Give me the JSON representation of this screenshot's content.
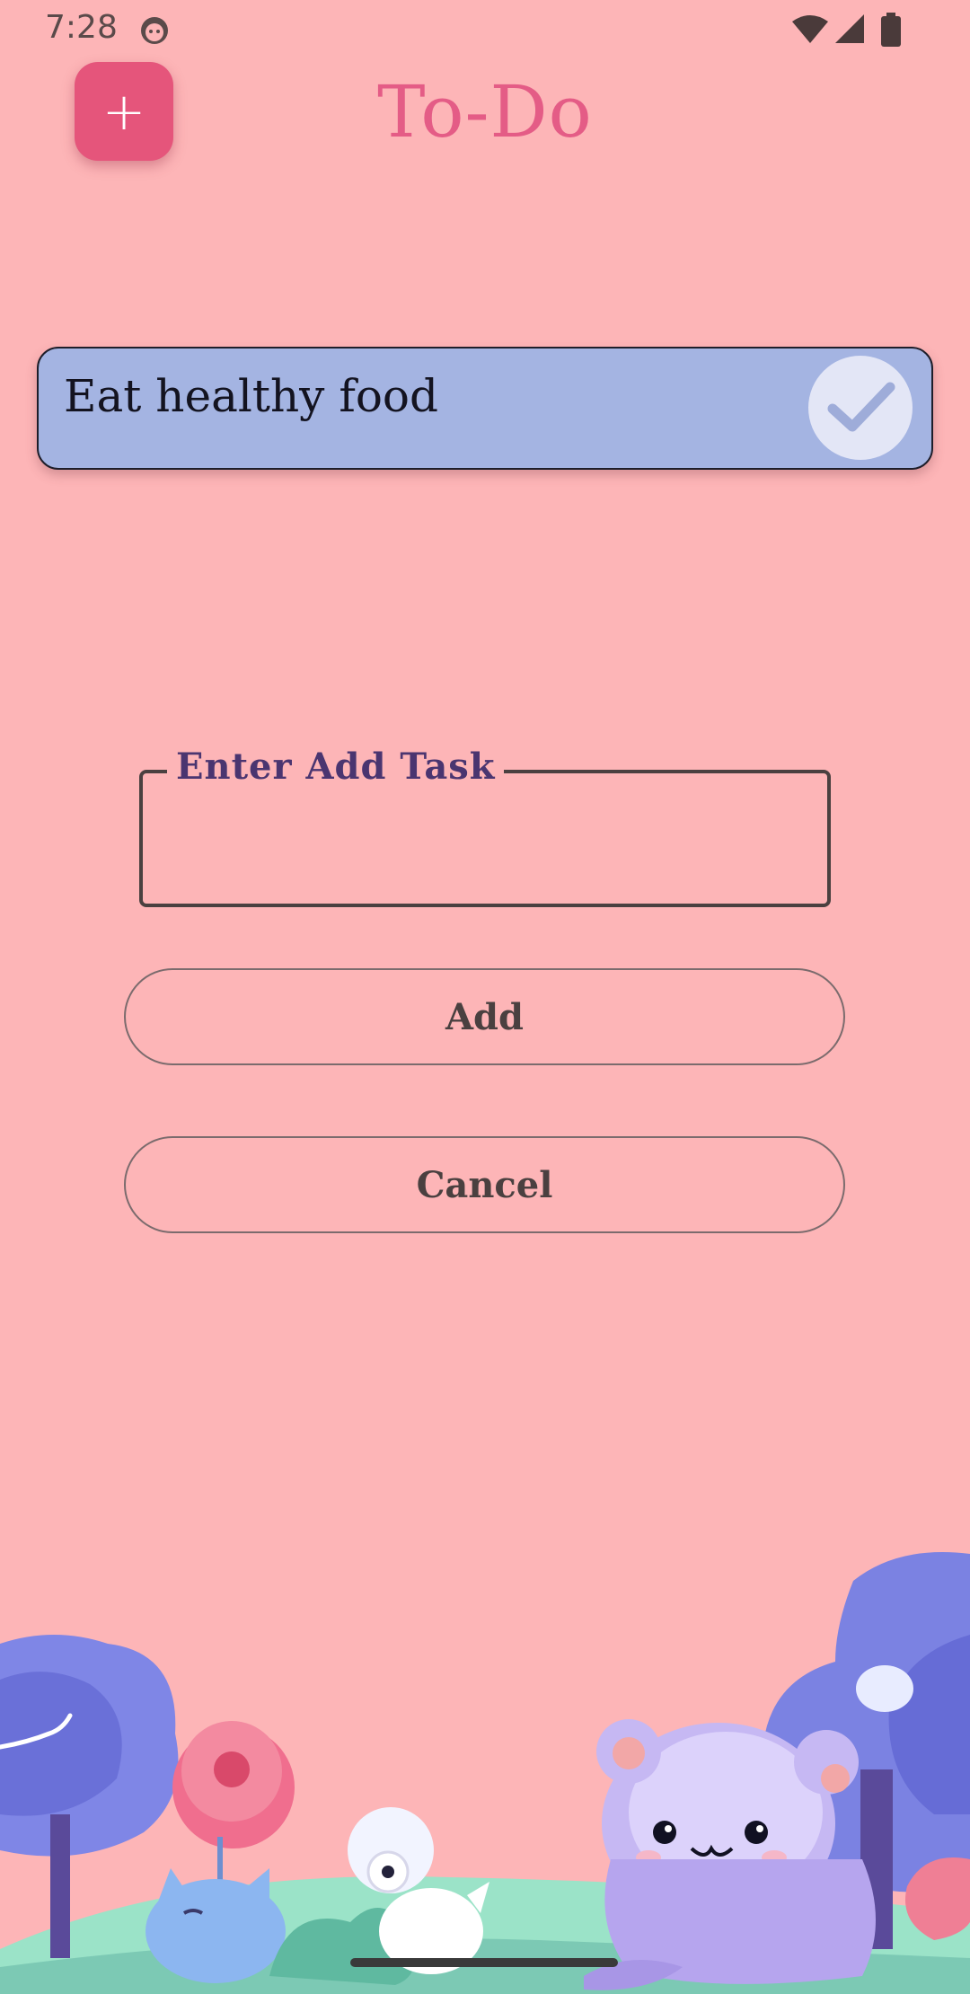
{
  "status_bar": {
    "time": "7:28",
    "icons": [
      "app-face-icon",
      "wifi-icon",
      "signal-icon",
      "battery-icon"
    ]
  },
  "header": {
    "add_button_label": "+",
    "title": "To-Do"
  },
  "tasks": [
    {
      "text": "Eat healthy food",
      "check_icon": "checkmark-icon"
    }
  ],
  "dialog": {
    "input_label": "Enter Add Task",
    "input_value": "",
    "add_label": "Add",
    "cancel_label": "Cancel"
  },
  "colors": {
    "background": "#fdb5b7",
    "accent": "#e5557b",
    "title": "#e45c86",
    "task_card": "#a4b4e2",
    "field_label": "#4a3570"
  },
  "illustration": {
    "icon": "cute-animals-forest-illustration"
  }
}
